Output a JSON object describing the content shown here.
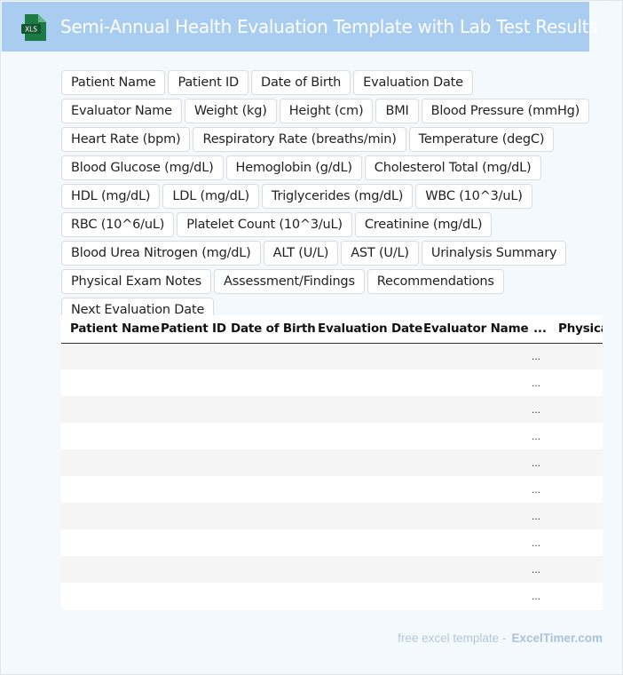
{
  "header": {
    "title": "Semi-Annual Health Evaluation Template with Lab Test Results",
    "icon": "xls-file-icon",
    "icon_text": "XLS",
    "icon_color": "#1e7a44"
  },
  "tags": [
    "Patient Name",
    "Patient ID",
    "Date of Birth",
    "Evaluation Date",
    "Evaluator Name",
    "Weight (kg)",
    "Height (cm)",
    "BMI",
    "Blood Pressure (mmHg)",
    "Heart Rate (bpm)",
    "Respiratory Rate (breaths/min)",
    "Temperature (degC)",
    "Blood Glucose (mg/dL)",
    "Hemoglobin (g/dL)",
    "Cholesterol Total (mg/dL)",
    "HDL (mg/dL)",
    "LDL (mg/dL)",
    "Triglycerides (mg/dL)",
    "WBC (10^3/uL)",
    "RBC (10^6/uL)",
    "Platelet Count (10^3/uL)",
    "Creatinine (mg/dL)",
    "Blood Urea Nitrogen (mg/dL)",
    "ALT (U/L)",
    "AST (U/L)",
    "Urinalysis Summary",
    "Physical Exam Notes",
    "Assessment/Findings",
    "Recommendations",
    "Next Evaluation Date"
  ],
  "table": {
    "columns": [
      "Patient Name",
      "Patient ID",
      "Date of Birth",
      "Evaluation Date",
      "Evaluator Name",
      "...",
      "Physical"
    ],
    "ellipsis": "...",
    "row_count": 10
  },
  "footer": {
    "prefix": "free excel template -",
    "brand": "ExcelTimer.com"
  }
}
